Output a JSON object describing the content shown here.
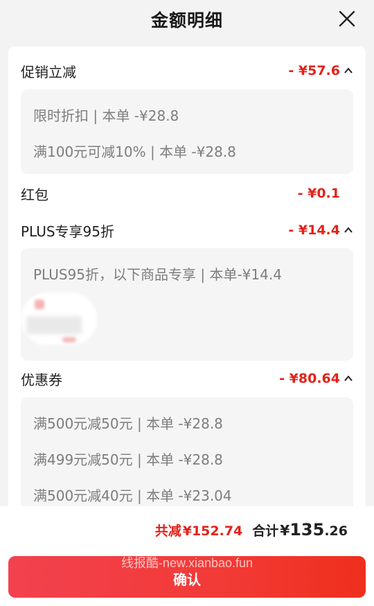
{
  "header": {
    "title": "金额明细",
    "close_icon": "close-icon"
  },
  "sections": {
    "promo": {
      "label": "促销立减",
      "amount": "- ¥57.6",
      "lines": [
        "限时折扣 | 本单 -¥28.8",
        "满100元可减10% | 本单 -¥28.8"
      ]
    },
    "redpacket": {
      "label": "红包",
      "amount": "- ¥0.1"
    },
    "plus": {
      "label": "PLUS专享95折",
      "amount": "- ¥14.4",
      "lines": [
        "PLUS95折，以下商品专享 | 本单-¥14.4"
      ]
    },
    "coupon": {
      "label": "优惠券",
      "amount": "- ¥80.64",
      "lines": [
        "满500元减50元 | 本单 -¥28.8",
        "满499元减50元 | 本单 -¥28.8",
        "满500元减40元 | 本单 -¥23.04"
      ]
    }
  },
  "footer": {
    "saved_label": "共减",
    "saved_value": "¥152.74",
    "total_label": "合计",
    "total_yen": "¥",
    "total_int": "135",
    "total_dec": ".26",
    "confirm_label": "确认",
    "watermark": "线报酷-new.xianbao.fun"
  },
  "colors": {
    "accent": "#e2231a",
    "button_start": "#f2424f",
    "button_end": "#ef2f1d"
  }
}
